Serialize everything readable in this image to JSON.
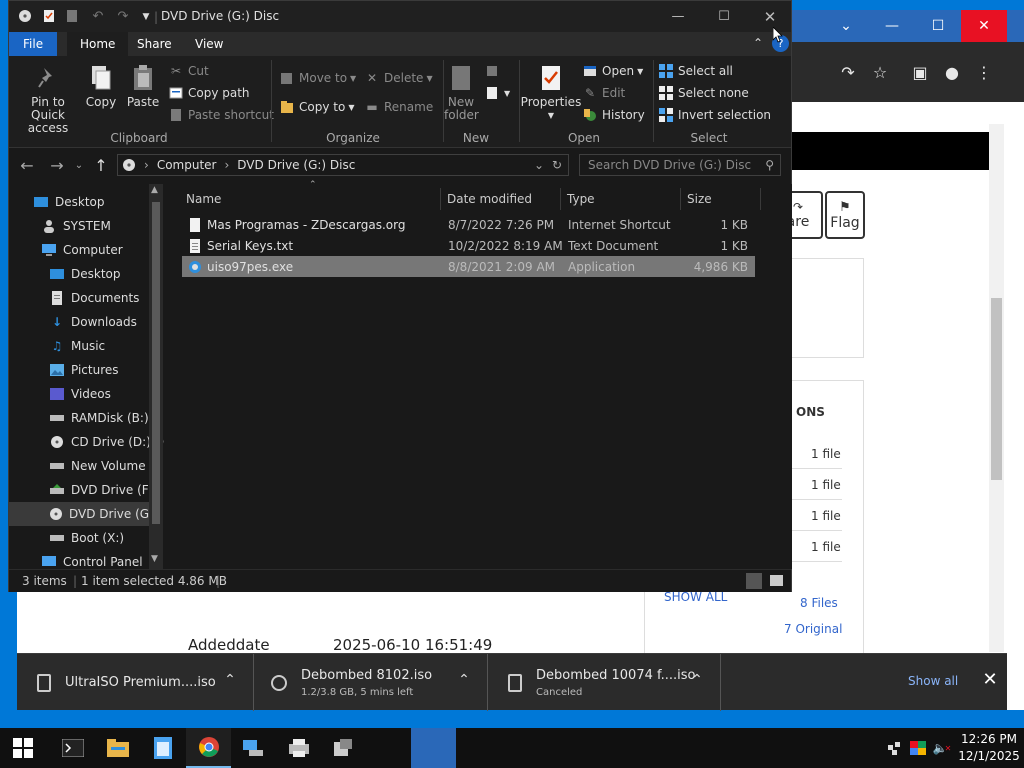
{
  "explorer": {
    "title": "DVD Drive (G:) Disc",
    "tabs": [
      "File",
      "Home",
      "Share",
      "View"
    ],
    "ribbon": {
      "clipboard": {
        "label": "Clipboard",
        "pin_to_quick_access": "Pin to Quick access",
        "copy": "Copy",
        "paste": "Paste",
        "cut": "Cut",
        "copy_path": "Copy path",
        "paste_shortcut": "Paste shortcut"
      },
      "organize": {
        "label": "Organize",
        "move_to": "Move to",
        "copy_to": "Copy to",
        "delete": "Delete",
        "rename": "Rename"
      },
      "new": {
        "label": "New",
        "new_folder": "New folder"
      },
      "open": {
        "label": "Open",
        "properties": "Properties",
        "open": "Open",
        "edit": "Edit",
        "history": "History"
      },
      "select": {
        "label": "Select",
        "select_all": "Select all",
        "select_none": "Select none",
        "invert_selection": "Invert selection"
      }
    },
    "address": {
      "crumbs": [
        "Computer",
        "DVD Drive (G:) Disc"
      ],
      "search_placeholder": "Search DVD Drive (G:) Disc"
    },
    "nav": [
      {
        "label": "Desktop",
        "icon": "desktop-icon"
      },
      {
        "label": "SYSTEM",
        "icon": "user-icon"
      },
      {
        "label": "Computer",
        "icon": "computer-icon"
      },
      {
        "label": "Desktop",
        "icon": "desktop-icon"
      },
      {
        "label": "Documents",
        "icon": "documents-icon"
      },
      {
        "label": "Downloads",
        "icon": "downloads-icon"
      },
      {
        "label": "Music",
        "icon": "music-icon"
      },
      {
        "label": "Pictures",
        "icon": "pictures-icon"
      },
      {
        "label": "Videos",
        "icon": "videos-icon"
      },
      {
        "label": "RAMDisk (B:)",
        "icon": "drive-icon"
      },
      {
        "label": "CD Drive (D:) D",
        "icon": "cd-drive-icon"
      },
      {
        "label": "New Volume (E",
        "icon": "drive-icon"
      },
      {
        "label": "DVD Drive (F:) .",
        "icon": "dvd-drive-icon"
      },
      {
        "label": "DVD Drive (G:)",
        "icon": "dvd-disc-icon"
      },
      {
        "label": "Boot (X:)",
        "icon": "drive-icon"
      },
      {
        "label": "Control Panel",
        "icon": "control-panel-icon"
      }
    ],
    "columns": [
      "Name",
      "Date modified",
      "Type",
      "Size"
    ],
    "files": [
      {
        "name": "Mas Programas - ZDescargas.org",
        "date": "8/7/2022 7:26 PM",
        "type": "Internet Shortcut",
        "size": "1 KB",
        "icon": "shortcut-file-icon"
      },
      {
        "name": "Serial Keys.txt",
        "date": "10/2/2022 8:19 AM",
        "type": "Text Document",
        "size": "1 KB",
        "icon": "text-file-icon"
      },
      {
        "name": "uiso97pes.exe",
        "date": "8/8/2021 2:09 AM",
        "type": "Application",
        "size": "4,986 KB",
        "icon": "app-exe-icon"
      }
    ],
    "status": {
      "items": "3 items",
      "selected": "1 item selected  4.86 MB"
    }
  },
  "web": {
    "share_partial": "are",
    "flag": "Flag",
    "section_partial": "ONS",
    "file_rows": [
      "1 file",
      "1 file",
      "1 file",
      "1 file"
    ],
    "show_all": "SHOW ALL",
    "files_count": "8 Files",
    "original_count": "7 Original",
    "added_label": "Addeddate",
    "added_value": "2025-06-10 16:51:49"
  },
  "downloads": [
    {
      "name": "UltraISO Premium....iso",
      "status": ""
    },
    {
      "name": "Debombed 8102.iso",
      "status": "1.2/3.8 GB, 5 mins left"
    },
    {
      "name": "Debombed 10074 f....iso",
      "status": "Canceled"
    }
  ],
  "downloads_show_all": "Show all",
  "taskbar": {
    "time": "12:26 PM",
    "date": "12/1/2025"
  },
  "colors": {
    "explorer_bg": "#191919",
    "file_tab": "#1a65c4",
    "chrome_title": "#2a68b8",
    "chrome_close": "#e81123",
    "link": "#3366cc"
  }
}
